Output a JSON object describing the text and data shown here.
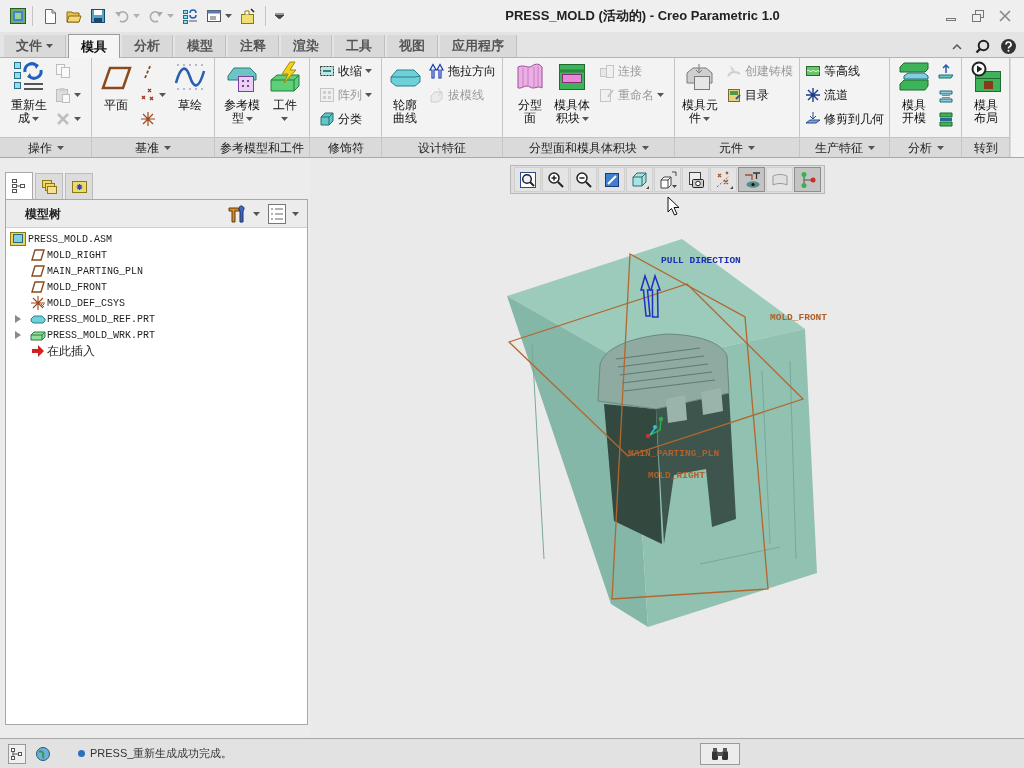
{
  "window": {
    "title": "PRESS_MOLD (活动的) - Creo Parametric 1.0"
  },
  "quick_access": [
    {
      "disabled": false,
      "dropdown": false
    },
    {
      "disabled": false,
      "dropdown": false
    },
    {
      "disabled": false,
      "dropdown": false
    },
    {
      "disabled": true,
      "dropdown": true
    },
    {
      "disabled": true,
      "dropdown": true
    },
    {
      "disabled": false,
      "dropdown": false
    },
    {
      "disabled": false,
      "dropdown": true
    },
    {
      "disabled": false,
      "dropdown": false
    }
  ],
  "ribbon": {
    "tabs": [
      {
        "label": "文件",
        "selected": false,
        "dropdown": true
      },
      {
        "label": "模具",
        "selected": true,
        "dropdown": false
      },
      {
        "label": "分析",
        "selected": false,
        "dropdown": false
      },
      {
        "label": "模型",
        "selected": false,
        "dropdown": false
      },
      {
        "label": "注释",
        "selected": false,
        "dropdown": false
      },
      {
        "label": "渲染",
        "selected": false,
        "dropdown": false
      },
      {
        "label": "工具",
        "selected": false,
        "dropdown": false
      },
      {
        "label": "视图",
        "selected": false,
        "dropdown": false
      },
      {
        "label": "应用程序",
        "selected": false,
        "dropdown": false
      }
    ],
    "groups": [
      {
        "label": "操作",
        "dropdown": true,
        "items": [
          {
            "kind": "large",
            "label": "重新生成",
            "dropdown": true,
            "disabled": false
          },
          {
            "kind": "stack",
            "items": [
              {
                "dropdown": false,
                "disabled": true
              },
              {
                "dropdown": true,
                "disabled": true
              },
              {
                "dropdown": true,
                "disabled": true
              }
            ]
          }
        ]
      },
      {
        "label": "基准",
        "dropdown": true,
        "items": [
          {
            "kind": "large",
            "label": "平面",
            "dropdown": false,
            "disabled": false
          },
          {
            "kind": "stack",
            "items": [
              {
                "dropdown": false,
                "disabled": false
              },
              {
                "dropdown": true,
                "disabled": false
              },
              {
                "dropdown": false,
                "disabled": false
              }
            ]
          },
          {
            "kind": "large",
            "label": "草绘",
            "dropdown": false,
            "disabled": false
          }
        ]
      },
      {
        "label": "参考模型和工件",
        "dropdown": false,
        "items": [
          {
            "kind": "large",
            "label": "参考模型",
            "dropdown": true,
            "disabled": false
          },
          {
            "kind": "large",
            "label": "工件",
            "dropdown": true,
            "disabled": false
          }
        ]
      },
      {
        "label": "修饰符",
        "dropdown": false,
        "items": [
          {
            "kind": "stack",
            "items": [
              {
                "label": "收缩",
                "dropdown": true,
                "disabled": false
              },
              {
                "label": "阵列",
                "dropdown": true,
                "disabled": true
              },
              {
                "label": "分类",
                "dropdown": false,
                "disabled": false
              }
            ]
          }
        ]
      },
      {
        "label": "设计特征",
        "dropdown": false,
        "items": [
          {
            "kind": "large",
            "label": "轮廓曲线",
            "dropdown": false,
            "disabled": false
          },
          {
            "kind": "stack",
            "items": [
              {
                "label": "拖拉方向",
                "dropdown": false,
                "disabled": false
              },
              {
                "label": "拔模线",
                "dropdown": false,
                "disabled": true
              }
            ]
          }
        ]
      },
      {
        "label": "分型面和模具体积块",
        "dropdown": true,
        "items": [
          {
            "kind": "large",
            "label": "分型面",
            "dropdown": false,
            "disabled": false
          },
          {
            "kind": "large",
            "label": "模具体积块",
            "dropdown": true,
            "disabled": false
          },
          {
            "kind": "stack",
            "items": [
              {
                "label": "连接",
                "dropdown": false,
                "disabled": true
              },
              {
                "label": "重命名",
                "dropdown": true,
                "disabled": true
              }
            ]
          }
        ]
      },
      {
        "label": "元件",
        "dropdown": true,
        "items": [
          {
            "kind": "large",
            "label": "模具元件",
            "dropdown": true,
            "disabled": false
          },
          {
            "kind": "stack",
            "items": [
              {
                "label": "创建铸模",
                "dropdown": false,
                "disabled": true
              },
              {
                "label": "目录",
                "dropdown": false,
                "disabled": false
              }
            ]
          }
        ]
      },
      {
        "label": "生产特征",
        "dropdown": true,
        "items": [
          {
            "kind": "stack",
            "items": [
              {
                "label": "等高线",
                "dropdown": false,
                "disabled": false
              },
              {
                "label": "流道",
                "dropdown": false,
                "disabled": false
              },
              {
                "label": "修剪到几何",
                "dropdown": false,
                "disabled": false
              }
            ]
          }
        ]
      },
      {
        "label": "分析",
        "dropdown": true,
        "items": [
          {
            "kind": "large",
            "label": "模具开模",
            "dropdown": false,
            "disabled": false
          },
          {
            "kind": "stack",
            "items": [
              {
                "dropdown": false,
                "disabled": false
              },
              {
                "dropdown": false,
                "disabled": false
              },
              {
                "dropdown": false,
                "disabled": false
              }
            ]
          }
        ]
      },
      {
        "label": "转到",
        "dropdown": false,
        "items": [
          {
            "kind": "large",
            "label": "模具布局",
            "dropdown": false,
            "disabled": false
          }
        ]
      }
    ]
  },
  "model_tree": {
    "tabs": [
      {
        "selected": true
      },
      {
        "selected": false
      },
      {
        "selected": false
      }
    ],
    "title": "模型树",
    "root": {
      "label": "PRESS_MOLD.ASM",
      "children": [
        {
          "kind": "plane",
          "label": "MOLD_RIGHT",
          "collapsed": false
        },
        {
          "kind": "plane",
          "label": "MAIN_PARTING_PLN",
          "collapsed": false
        },
        {
          "kind": "plane",
          "label": "MOLD_FRONT",
          "collapsed": false
        },
        {
          "kind": "csys",
          "label": "MOLD_DEF_CSYS",
          "collapsed": false
        },
        {
          "kind": "refpart",
          "label": "PRESS_MOLD_REF.PRT",
          "collapsed": true
        },
        {
          "kind": "workpiece",
          "label": "PRESS_MOLD_WRK.PRT",
          "collapsed": true
        },
        {
          "kind": "insert",
          "label": "在此插入",
          "collapsed": false
        }
      ]
    }
  },
  "view_toolbar": [
    {
      "pressed": false
    },
    {
      "pressed": false
    },
    {
      "pressed": false
    },
    {
      "pressed": false
    },
    {
      "pressed": false
    },
    {
      "pressed": false
    },
    {
      "pressed": false
    },
    {
      "pressed": false
    },
    {
      "pressed": true
    },
    {
      "pressed": false
    },
    {
      "pressed": true
    }
  ],
  "annotations": [
    {
      "kind": "direction",
      "text": "PULL DIRECTION"
    },
    {
      "kind": "datum",
      "text": "MOLD_FRONT"
    },
    {
      "kind": "datum",
      "text": "MAIN_PARTING_PLN"
    },
    {
      "kind": "datum",
      "text": "MOLD_RIGHT"
    }
  ],
  "status_bar": {
    "message": "PRESS_重新生成成功完成。"
  }
}
